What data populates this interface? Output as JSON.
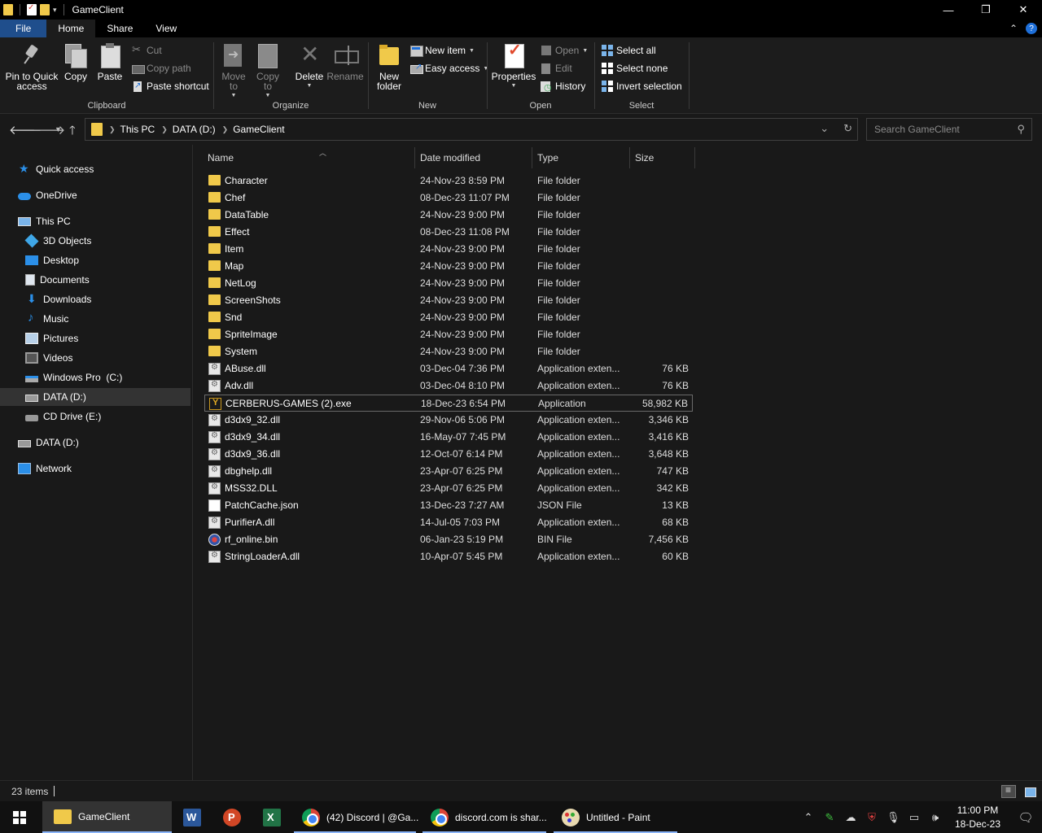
{
  "window": {
    "title": "GameClient",
    "controls": {
      "minimize": "—",
      "maximize": "❐",
      "close": "✕"
    }
  },
  "ribbon_tabs": [
    "File",
    "Home",
    "Share",
    "View"
  ],
  "ribbon": {
    "clipboard": {
      "label": "Clipboard",
      "pin": "Pin to Quick access",
      "copy": "Copy",
      "paste": "Paste",
      "cut": "Cut",
      "copy_path": "Copy path",
      "paste_shortcut": "Paste shortcut"
    },
    "organize": {
      "label": "Organize",
      "move_to": "Move to",
      "copy_to": "Copy to",
      "delete": "Delete",
      "rename": "Rename"
    },
    "new": {
      "label": "New",
      "new_folder": "New folder",
      "new_item": "New item",
      "easy_access": "Easy access"
    },
    "open": {
      "label": "Open",
      "properties": "Properties",
      "open": "Open",
      "edit": "Edit",
      "history": "History"
    },
    "select": {
      "label": "Select",
      "select_all": "Select all",
      "select_none": "Select none",
      "invert": "Invert selection"
    }
  },
  "address": {
    "crumbs": [
      "This PC",
      "DATA (D:)",
      "GameClient"
    ],
    "search_placeholder": "Search GameClient"
  },
  "nav_pane": [
    {
      "label": "Quick access",
      "icon": "star-icon"
    },
    {
      "label": "OneDrive",
      "icon": "cloud-icon"
    },
    {
      "label": "This PC",
      "icon": "computer-icon"
    },
    {
      "label": "3D Objects",
      "icon": "cube-icon"
    },
    {
      "label": "Desktop",
      "icon": "desktop-icon"
    },
    {
      "label": "Documents",
      "icon": "document-icon"
    },
    {
      "label": "Downloads",
      "icon": "download-icon"
    },
    {
      "label": "Music",
      "icon": "music-icon"
    },
    {
      "label": "Pictures",
      "icon": "pictures-icon"
    },
    {
      "label": "Videos",
      "icon": "videos-icon"
    },
    {
      "label": "Windows Pro  (C:)",
      "icon": "windows-drive-icon"
    },
    {
      "label": "DATA (D:)",
      "icon": "drive-icon",
      "selected": true
    },
    {
      "label": "CD Drive (E:)",
      "icon": "cd-drive-icon"
    },
    {
      "label": "DATA (D:)",
      "icon": "drive-icon"
    },
    {
      "label": "Network",
      "icon": "network-icon"
    }
  ],
  "columns": [
    "Name",
    "Date modified",
    "Type",
    "Size"
  ],
  "files": [
    {
      "name": "Character",
      "date": "24-Nov-23 8:59 PM",
      "type": "File folder",
      "size": "",
      "icon": "folder"
    },
    {
      "name": "Chef",
      "date": "08-Dec-23 11:07 PM",
      "type": "File folder",
      "size": "",
      "icon": "folder"
    },
    {
      "name": "DataTable",
      "date": "24-Nov-23 9:00 PM",
      "type": "File folder",
      "size": "",
      "icon": "folder"
    },
    {
      "name": "Effect",
      "date": "08-Dec-23 11:08 PM",
      "type": "File folder",
      "size": "",
      "icon": "folder"
    },
    {
      "name": "Item",
      "date": "24-Nov-23 9:00 PM",
      "type": "File folder",
      "size": "",
      "icon": "folder"
    },
    {
      "name": "Map",
      "date": "24-Nov-23 9:00 PM",
      "type": "File folder",
      "size": "",
      "icon": "folder"
    },
    {
      "name": "NetLog",
      "date": "24-Nov-23 9:00 PM",
      "type": "File folder",
      "size": "",
      "icon": "folder"
    },
    {
      "name": "ScreenShots",
      "date": "24-Nov-23 9:00 PM",
      "type": "File folder",
      "size": "",
      "icon": "folder"
    },
    {
      "name": "Snd",
      "date": "24-Nov-23 9:00 PM",
      "type": "File folder",
      "size": "",
      "icon": "folder"
    },
    {
      "name": "SpriteImage",
      "date": "24-Nov-23 9:00 PM",
      "type": "File folder",
      "size": "",
      "icon": "folder"
    },
    {
      "name": "System",
      "date": "24-Nov-23 9:00 PM",
      "type": "File folder",
      "size": "",
      "icon": "folder"
    },
    {
      "name": "ABuse.dll",
      "date": "03-Dec-04 7:36 PM",
      "type": "Application exten...",
      "size": "76 KB",
      "icon": "dll"
    },
    {
      "name": "Adv.dll",
      "date": "03-Dec-04 8:10 PM",
      "type": "Application exten...",
      "size": "76 KB",
      "icon": "dll"
    },
    {
      "name": "CERBERUS-GAMES (2).exe",
      "date": "18-Dec-23 6:54 PM",
      "type": "Application",
      "size": "58,982 KB",
      "icon": "exe",
      "focused": true
    },
    {
      "name": "d3dx9_32.dll",
      "date": "29-Nov-06 5:06 PM",
      "type": "Application exten...",
      "size": "3,346 KB",
      "icon": "dll"
    },
    {
      "name": "d3dx9_34.dll",
      "date": "16-May-07 7:45 PM",
      "type": "Application exten...",
      "size": "3,416 KB",
      "icon": "dll"
    },
    {
      "name": "d3dx9_36.dll",
      "date": "12-Oct-07 6:14 PM",
      "type": "Application exten...",
      "size": "3,648 KB",
      "icon": "dll"
    },
    {
      "name": "dbghelp.dll",
      "date": "23-Apr-07 6:25 PM",
      "type": "Application exten...",
      "size": "747 KB",
      "icon": "dll"
    },
    {
      "name": "MSS32.DLL",
      "date": "23-Apr-07 6:25 PM",
      "type": "Application exten...",
      "size": "342 KB",
      "icon": "dll"
    },
    {
      "name": "PatchCache.json",
      "date": "13-Dec-23 7:27 AM",
      "type": "JSON File",
      "size": "13 KB",
      "icon": "json"
    },
    {
      "name": "PurifierA.dll",
      "date": "14-Jul-05 7:03 PM",
      "type": "Application exten...",
      "size": "68 KB",
      "icon": "dll"
    },
    {
      "name": "rf_online.bin",
      "date": "06-Jan-23 5:19 PM",
      "type": "BIN File",
      "size": "7,456 KB",
      "icon": "bin"
    },
    {
      "name": "StringLoaderA.dll",
      "date": "10-Apr-07 5:45 PM",
      "type": "Application exten...",
      "size": "60 KB",
      "icon": "dll"
    }
  ],
  "status": {
    "item_count": "23 items"
  },
  "taskbar": {
    "apps": [
      {
        "label": "GameClient",
        "icon": "file-explorer-icon"
      },
      {
        "label": "",
        "icon": "word-icon"
      },
      {
        "label": "",
        "icon": "powerpoint-icon"
      },
      {
        "label": "",
        "icon": "excel-icon"
      },
      {
        "label": "(42) Discord | @Ga...",
        "icon": "chrome-icon"
      },
      {
        "label": "discord.com is shar...",
        "icon": "chrome-icon"
      },
      {
        "label": "Untitled - Paint",
        "icon": "paint-icon"
      }
    ],
    "time": "11:00 PM",
    "date": "18-Dec-23"
  },
  "colors": {
    "background": "#191919",
    "file_tab": "#1f4e8c",
    "folder": "#f0c94a",
    "accent": "#2b8fe8"
  }
}
